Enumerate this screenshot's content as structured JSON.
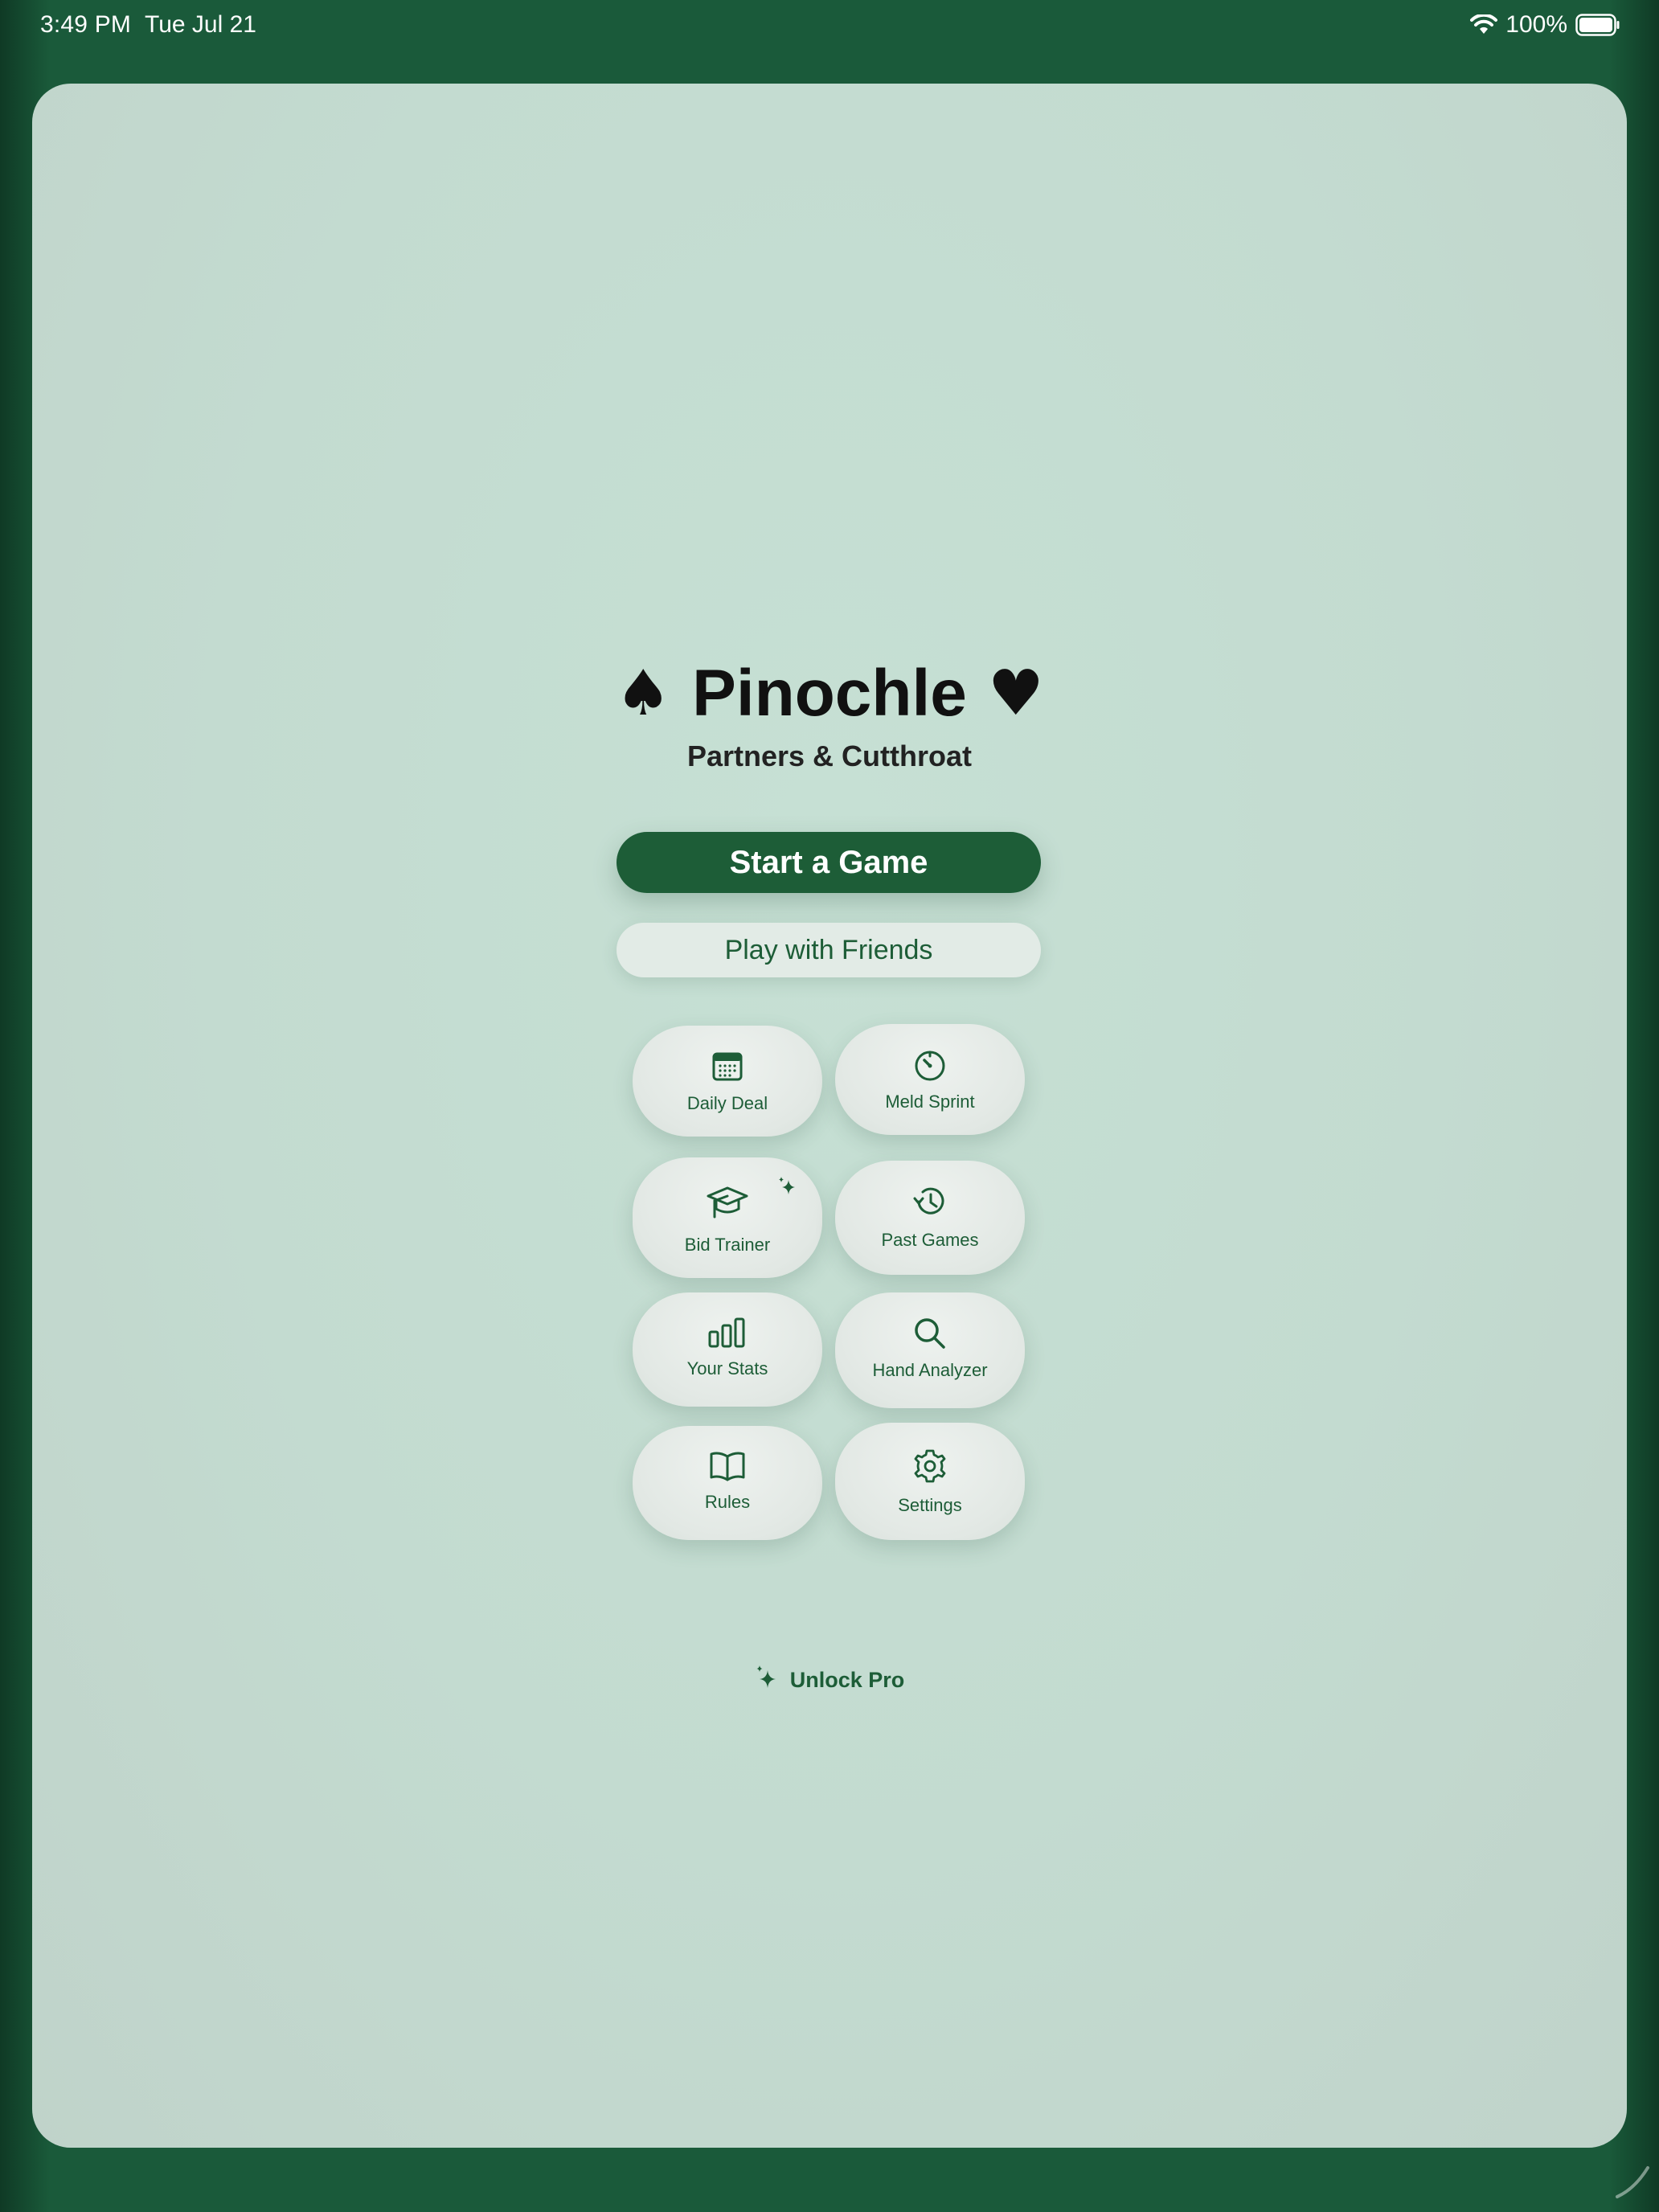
{
  "status_bar": {
    "time": "3:49 PM",
    "date": "Tue Jul 21",
    "battery": "100%",
    "wifi_icon": "wifi-icon",
    "battery_icon": "battery-full-icon"
  },
  "header": {
    "left_suit": "♠",
    "title": "Pinochle",
    "right_suit": "♥",
    "subtitle": "Partners & Cutthroat"
  },
  "actions": {
    "primary": "Start a Game",
    "secondary": "Play with Friends"
  },
  "tiles": [
    {
      "label": "Daily Deal",
      "icon": "calendar-icon"
    },
    {
      "label": "Meld Sprint",
      "icon": "timer-icon"
    },
    {
      "label": "Bid Trainer",
      "icon": "graduation-cap-icon",
      "badge": "sparkle-icon"
    },
    {
      "label": "Past Games",
      "icon": "history-icon"
    },
    {
      "label": "Your Stats",
      "icon": "bar-chart-icon"
    },
    {
      "label": "Hand Analyzer",
      "icon": "search-icon"
    },
    {
      "label": "Rules",
      "icon": "book-icon"
    },
    {
      "label": "Settings",
      "icon": "gear-icon"
    }
  ],
  "footer": {
    "unlock_label": "Unlock Pro",
    "unlock_icon": "sparkle-icon"
  },
  "colors": {
    "brand_green": "#1d5d37",
    "frame_green": "#1a5a3a",
    "card_bg": "#c3dbd0"
  }
}
